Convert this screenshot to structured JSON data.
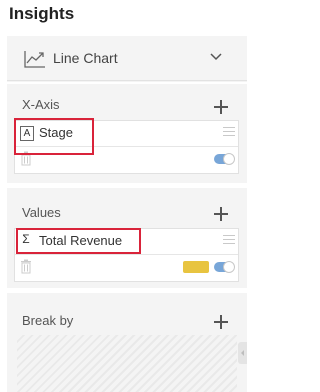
{
  "header": {
    "title": "Insights"
  },
  "chart_type": {
    "label": "Line Chart",
    "icon": "line-chart-icon"
  },
  "sections": {
    "x_axis": {
      "label": "X-Axis",
      "field": {
        "type_badge": "A",
        "name": "Stage"
      }
    },
    "values": {
      "label": "Values",
      "field": {
        "type_badge": "Σ",
        "name": "Total Revenue",
        "color": "#e8c440"
      }
    },
    "break_by": {
      "label": "Break by"
    }
  },
  "colors": {
    "highlight": "#d9233a",
    "toggle_on": "#78a6d8",
    "panel_bg": "#f4f4f4"
  }
}
